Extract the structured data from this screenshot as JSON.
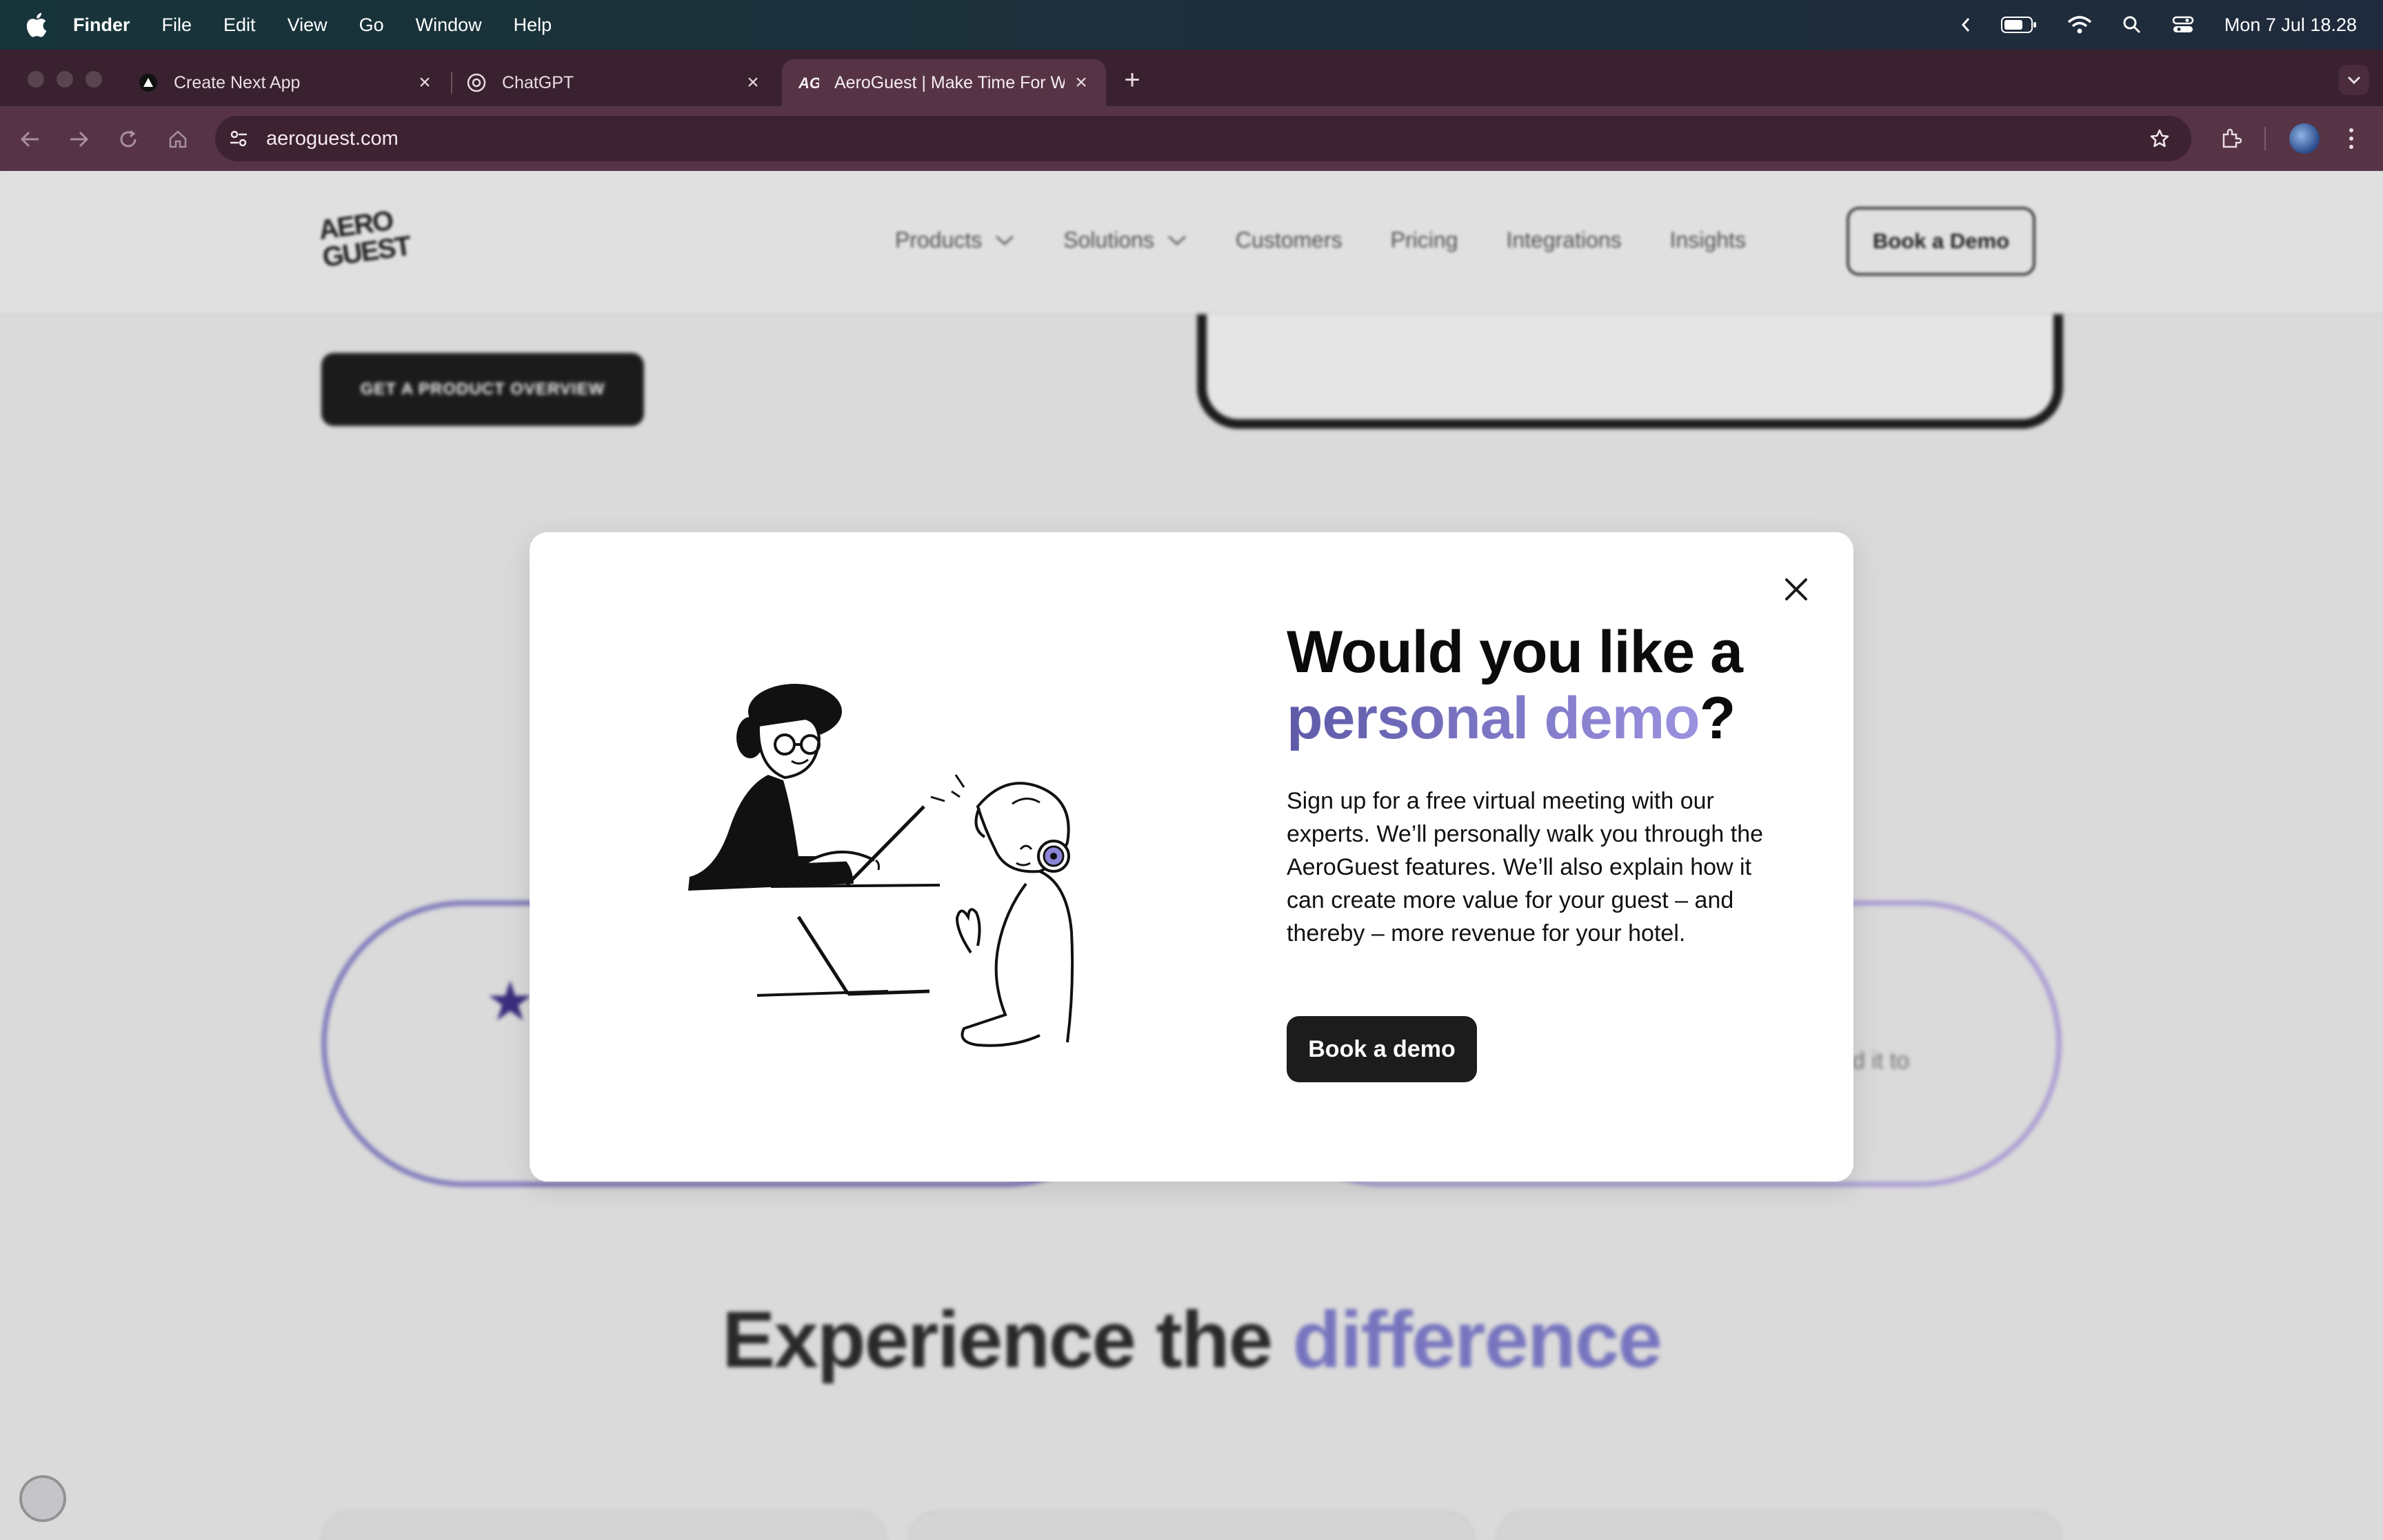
{
  "menubar": {
    "app": "Finder",
    "items": [
      "File",
      "Edit",
      "View",
      "Go",
      "Window",
      "Help"
    ],
    "datetime": "Mon 7 Jul  18.28"
  },
  "tabs": [
    {
      "title": "Create Next App",
      "favicon": "triangle-icon"
    },
    {
      "title": "ChatGPT",
      "favicon": "chatgpt-icon"
    },
    {
      "title": "AeroGuest | Make Time For W",
      "favicon": "aeroguest-icon",
      "active": true
    }
  ],
  "toolbar": {
    "url": "aeroguest.com"
  },
  "site": {
    "logo_line1": "AERO",
    "logo_line2": "GUEST",
    "nav": [
      "Products",
      "Solutions",
      "Customers",
      "Pricing",
      "Integrations",
      "Insights"
    ],
    "book_demo": "Book a Demo",
    "overview_button": "GET A PRODUCT OVERVIEW",
    "pill_text": "d it to",
    "headline_a": "Experience the ",
    "headline_b": "difference"
  },
  "modal": {
    "title_a": "Would you like a ",
    "title_b": "personal demo",
    "title_c": "?",
    "body": "Sign up for a free virtual meeting with our experts. We’ll personally walk you through the AeroGuest features. We’ll also explain how it can create more value for your guest – and thereby – more revenue for your hotel.",
    "cta": "Book a demo"
  },
  "colors": {
    "accent": "#7d7ac9",
    "accent_dark": "#5e5aa8",
    "button": "#1c1c1c"
  }
}
